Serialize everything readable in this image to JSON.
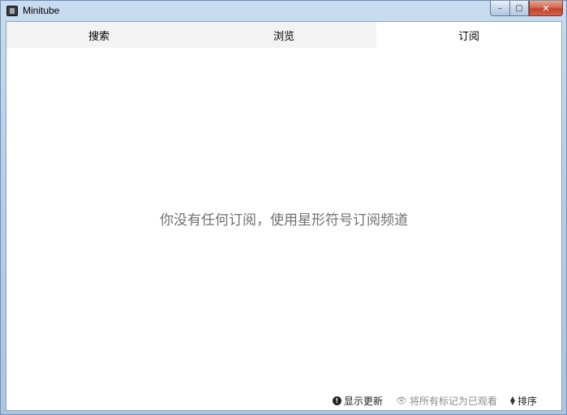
{
  "window": {
    "title": "Minitube",
    "icon": "minitube-app-icon",
    "controls": {
      "minimize": "–",
      "maximize": "▢",
      "close": "✕"
    }
  },
  "tabs": [
    {
      "label": "搜索",
      "active": false
    },
    {
      "label": "浏览",
      "active": false
    },
    {
      "label": "订阅",
      "active": true
    }
  ],
  "main": {
    "empty_message": "你没有任何订阅，使用星形符号订阅频道"
  },
  "footer": {
    "show_updates": {
      "icon": "info-icon",
      "label": "显示更新"
    },
    "mark_all_watched": {
      "icon": "eye-icon",
      "label": "将所有标记为已观看",
      "enabled": false
    },
    "sort": {
      "icon": "sort-icon",
      "label": "排序"
    }
  }
}
